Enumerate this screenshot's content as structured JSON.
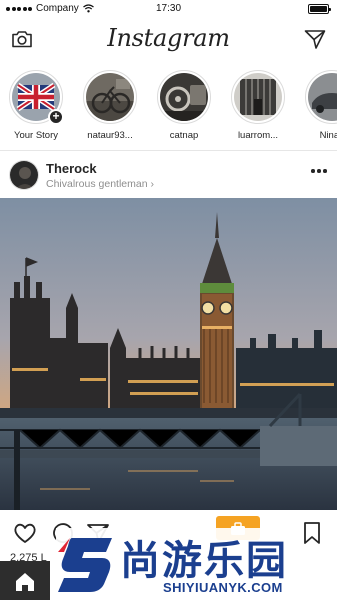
{
  "status_bar": {
    "carrier": "Company",
    "time": "17:30"
  },
  "header": {
    "title": "Instagram"
  },
  "stories": [
    {
      "label": "Your Story",
      "add_badge": "+"
    },
    {
      "label": "nataur93..."
    },
    {
      "label": "catnap"
    },
    {
      "label": "luarrom..."
    },
    {
      "label": "Ninan"
    }
  ],
  "post": {
    "username": "Therock",
    "subtitle": "Chivalrous gentleman ›",
    "likes": "2,275 L"
  },
  "watermark": {
    "chinese": "尚游乐园",
    "english": "SHIYIUANYK.COM",
    "logo_letter": "S"
  },
  "colors": {
    "text": "#262626",
    "muted": "#8e8e8e",
    "divider": "#e6e6e6",
    "badge": "#f5a323",
    "watermark": "#1b3f8f"
  }
}
